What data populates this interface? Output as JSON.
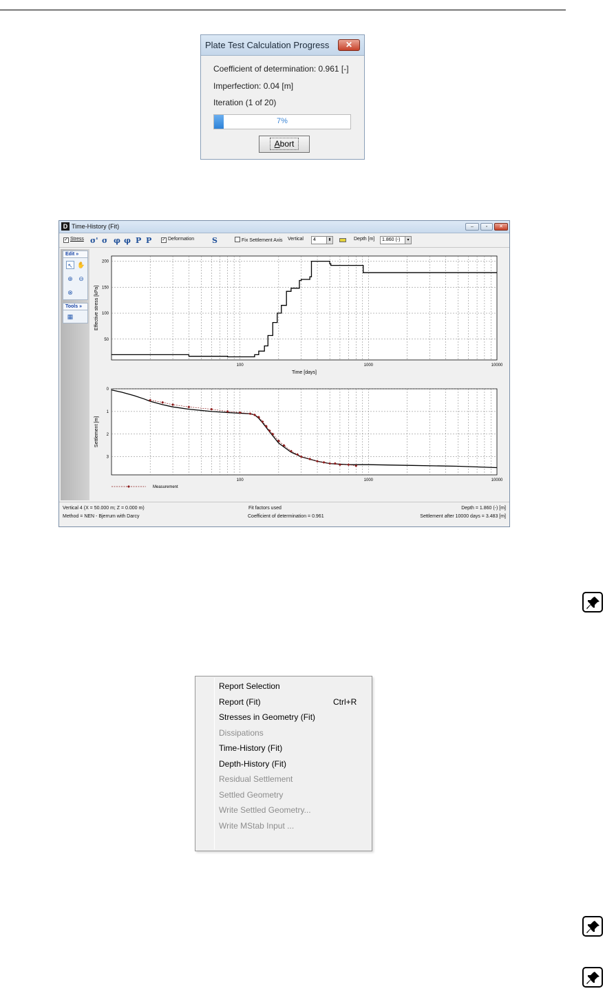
{
  "progress_dialog": {
    "title": "Plate Test Calculation Progress",
    "close_glyph": "✕",
    "coefficient_text": "Coefficient of determination: 0.961 [-]",
    "imperfection_text": "Imperfection: 0.04 [m]",
    "iteration_text": "Iteration (1 of 20)",
    "progress_fraction": 0.07,
    "progress_label": "7%",
    "abort_prefix": "",
    "abort_underlined": "A",
    "abort_rest": "bort"
  },
  "time_history": {
    "title": "Time-History (Fit)",
    "logo": "D",
    "window_buttons": [
      "–",
      "▫",
      "✕"
    ],
    "toolbar": {
      "stress_label": "Stress",
      "deformation_label": "Deformation",
      "fix_axis_label": "Fix Settlement Axis",
      "vertical_label": "Vertical",
      "vertical_value": "4",
      "depth_label": "Depth [m]",
      "depth_value": "1.860 (-)",
      "icons": [
        "σ'",
        "σ",
        "φ",
        "φ",
        "P",
        "P"
      ],
      "s_icon": "S"
    },
    "side_panel": {
      "edit_label": "Edit",
      "tools_label": "Tools"
    },
    "status": {
      "left_line1": "Vertical 4 (X = 50.000 m; Z = 0.000 m)",
      "left_line2": "Method = NEN - Bjerrum with Darcy",
      "center_line1": "Fit factors used",
      "center_line2": "Coefficient of determination = 0.961",
      "right_line1": "Depth = 1.860 (-) [m]",
      "right_line2": "Settlement after 10000 days = 3.483 [m]"
    }
  },
  "chart_data": [
    {
      "type": "line",
      "xscale": "log",
      "xlabel": "Time [days]",
      "ylabel": "Effective stress [kPa]",
      "xlim": [
        10,
        10000
      ],
      "ylim": [
        10,
        210
      ],
      "xticks": [
        "100",
        "1000",
        "10000"
      ],
      "yticks": [
        "50",
        "100",
        "150",
        "200"
      ],
      "grid": true,
      "series": [
        {
          "x": [
            10,
            20,
            40,
            80,
            100,
            115,
            130,
            140,
            155,
            165,
            180,
            195,
            210,
            230,
            250,
            290,
            300,
            350,
            360,
            430,
            500,
            510,
            900,
            910,
            10000
          ],
          "y": [
            20,
            20,
            17,
            16,
            16,
            16,
            20,
            27,
            37,
            57,
            82,
            100,
            115,
            142,
            148,
            163,
            165,
            170,
            200,
            200,
            195,
            192,
            192,
            178,
            178
          ],
          "step": true
        }
      ]
    },
    {
      "type": "line",
      "xscale": "log",
      "ylabel": "Settlement [m]",
      "xlim": [
        10,
        10000
      ],
      "ylim": [
        0,
        3.8
      ],
      "yinverted": true,
      "xticks": [
        "100",
        "1000",
        "10000"
      ],
      "yticks": [
        "0",
        "1",
        "2",
        "3"
      ],
      "grid": true,
      "legend": "bottom-left",
      "series": [
        {
          "name": "",
          "x": [
            10,
            12,
            15,
            18,
            20,
            25,
            30,
            40,
            60,
            80,
            100,
            120,
            130,
            140,
            150,
            170,
            200,
            250,
            300,
            400,
            500,
            700,
            1000,
            2000,
            5000,
            10000
          ],
          "y": [
            0.05,
            0.15,
            0.3,
            0.45,
            0.55,
            0.7,
            0.8,
            0.9,
            1.0,
            1.05,
            1.08,
            1.1,
            1.15,
            1.3,
            1.5,
            1.9,
            2.4,
            2.8,
            3.0,
            3.2,
            3.3,
            3.35,
            3.35,
            3.38,
            3.42,
            3.48
          ]
        },
        {
          "name": "Measurement",
          "x": [
            20,
            25,
            30,
            40,
            60,
            80,
            100,
            120,
            130,
            140,
            150,
            160,
            170,
            180,
            200,
            220,
            250,
            280,
            300,
            350,
            400,
            450,
            500,
            550,
            600,
            700,
            800
          ],
          "y": [
            0.5,
            0.6,
            0.7,
            0.8,
            0.9,
            1.0,
            1.05,
            1.1,
            1.15,
            1.25,
            1.45,
            1.65,
            1.85,
            2.0,
            2.3,
            2.5,
            2.75,
            2.9,
            3.0,
            3.1,
            3.2,
            3.25,
            3.3,
            3.3,
            3.35,
            3.35,
            3.4
          ]
        }
      ]
    }
  ],
  "context_menu": {
    "items": [
      {
        "label": "Report Selection",
        "enabled": true,
        "shortcut": ""
      },
      {
        "label": "Report (Fit)",
        "enabled": true,
        "shortcut": "Ctrl+R"
      },
      {
        "label": "Stresses in Geometry (Fit)",
        "enabled": true,
        "shortcut": ""
      },
      {
        "label": "Dissipations",
        "enabled": false,
        "shortcut": ""
      },
      {
        "label": "Time-History (Fit)",
        "enabled": true,
        "shortcut": ""
      },
      {
        "label": "Depth-History (Fit)",
        "enabled": true,
        "shortcut": ""
      },
      {
        "label": "Residual Settlement",
        "enabled": false,
        "shortcut": ""
      },
      {
        "label": "Settled Geometry",
        "enabled": false,
        "shortcut": ""
      },
      {
        "label": "Write Settled Geometry...",
        "enabled": false,
        "shortcut": ""
      },
      {
        "label": "Write MStab Input ...",
        "enabled": false,
        "shortcut": ""
      }
    ]
  },
  "colors": {
    "progress_fill": "#2e83d8",
    "measurement": "#8b1a1a",
    "menu_disabled": "#8d8d8d"
  }
}
